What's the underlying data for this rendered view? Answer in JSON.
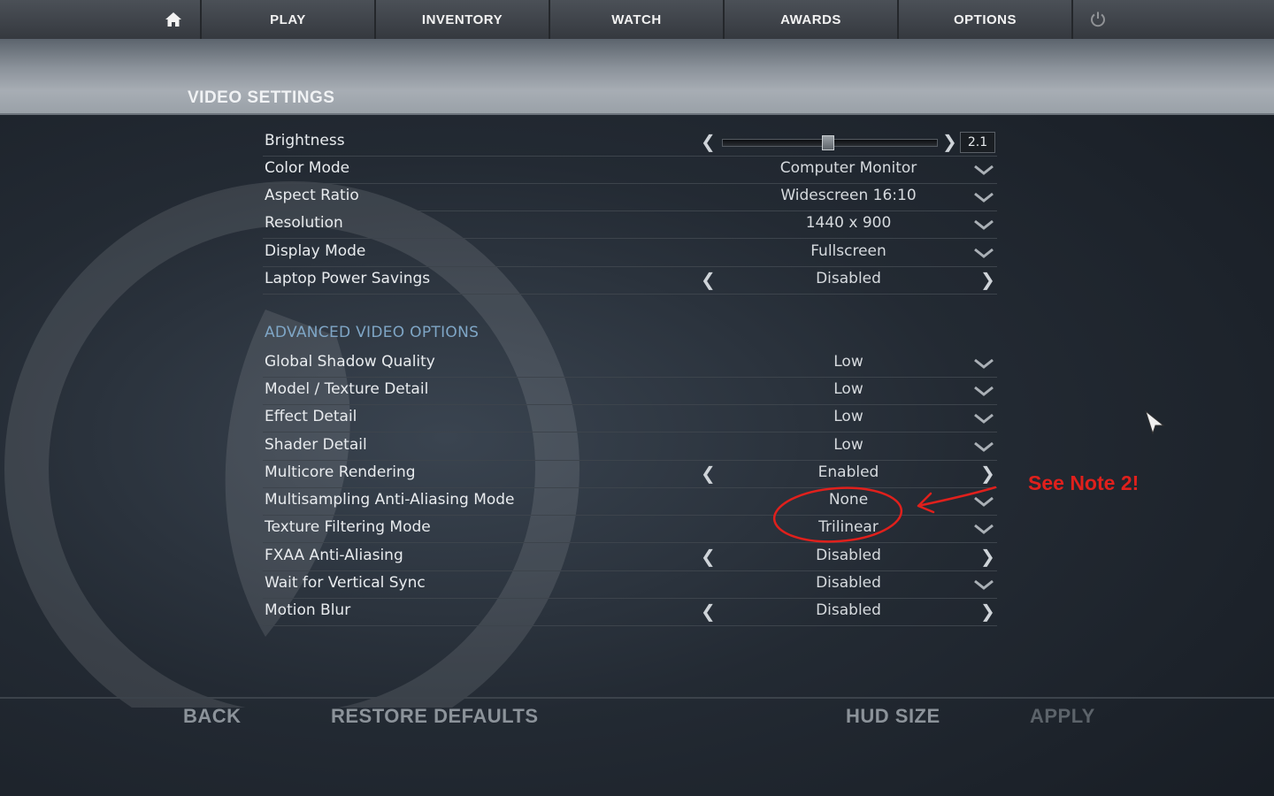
{
  "nav": {
    "items": [
      {
        "id": "play",
        "label": "PLAY"
      },
      {
        "id": "inventory",
        "label": "INVENTORY"
      },
      {
        "id": "watch",
        "label": "WATCH"
      },
      {
        "id": "awards",
        "label": "AWARDS"
      },
      {
        "id": "options",
        "label": "OPTIONS"
      }
    ],
    "home_icon": "home-icon",
    "power_icon": "power-icon"
  },
  "page": {
    "title": "VIDEO SETTINGS"
  },
  "basic": [
    {
      "label": "Brightness",
      "control": "slider",
      "value": "2.1",
      "level": 0.49
    },
    {
      "label": "Color Mode",
      "control": "dropdown",
      "value": "Computer Monitor"
    },
    {
      "label": "Aspect Ratio",
      "control": "dropdown",
      "value": "Widescreen 16:10"
    },
    {
      "label": "Resolution",
      "control": "dropdown",
      "value": "1440 x 900"
    },
    {
      "label": "Display Mode",
      "control": "dropdown",
      "value": "Fullscreen"
    },
    {
      "label": "Laptop Power Savings",
      "control": "toggle",
      "value": "Disabled"
    }
  ],
  "advanced": {
    "title": "ADVANCED VIDEO OPTIONS",
    "rows": [
      {
        "label": "Global Shadow Quality",
        "control": "dropdown",
        "value": "Low"
      },
      {
        "label": "Model / Texture Detail",
        "control": "dropdown",
        "value": "Low"
      },
      {
        "label": "Effect Detail",
        "control": "dropdown",
        "value": "Low"
      },
      {
        "label": "Shader Detail",
        "control": "dropdown",
        "value": "Low"
      },
      {
        "label": "Multicore Rendering",
        "control": "toggle",
        "value": "Enabled"
      },
      {
        "label": "Multisampling Anti-Aliasing Mode",
        "control": "dropdown",
        "value": "None"
      },
      {
        "label": "Texture Filtering Mode",
        "control": "dropdown",
        "value": "Trilinear"
      },
      {
        "label": "FXAA Anti-Aliasing",
        "control": "toggle",
        "value": "Disabled"
      },
      {
        "label": "Wait for Vertical Sync",
        "control": "dropdown",
        "value": "Disabled"
      },
      {
        "label": "Motion Blur",
        "control": "toggle",
        "value": "Disabled"
      }
    ]
  },
  "bottom": {
    "back": "BACK",
    "restore": "RESTORE DEFAULTS",
    "hud": "HUD SIZE",
    "apply": "APPLY"
  },
  "annotation": {
    "note": "See Note 2!",
    "color": "#e0201c"
  }
}
